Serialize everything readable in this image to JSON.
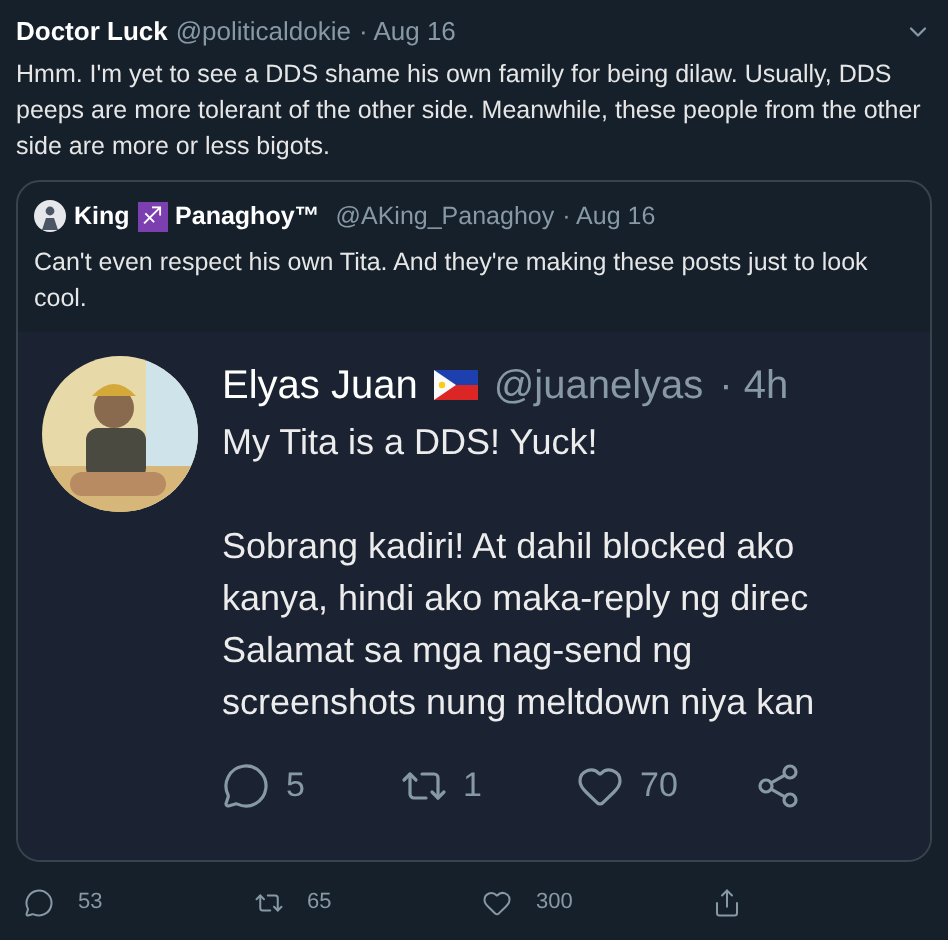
{
  "tweet": {
    "name": "Doctor Luck",
    "handle": "@politicaldokie",
    "time": "· Aug 16",
    "text": "Hmm. I'm yet to see a DDS shame his own family for being dilaw. Usually, DDS peeps are more tolerant of the other side. Meanwhile, these people from the other side are more or less bigots.",
    "quote": {
      "name": "King",
      "symbol": "♐",
      "name_end": "Panaghoy™",
      "handle": "@AKing_Panaghoy",
      "time": "· Aug 16",
      "text": "Can't even respect his own Tita. And they're making these posts just to look cool.",
      "screenshot": {
        "name": "Elyas Juan",
        "handle": "@juanelyas",
        "time": "· 4h",
        "first_line": "My Tita is a DDS! Yuck!",
        "lines": [
          "Sobrang kadiri! At dahil blocked ako",
          "kanya, hindi ako maka-reply ng direc",
          "Salamat sa mga nag-send ng",
          "screenshots nung meltdown niya kan"
        ],
        "actions": [
          {
            "kind": "reply",
            "count": "5"
          },
          {
            "kind": "retweet",
            "count": "1"
          },
          {
            "kind": "like",
            "count": "70"
          },
          {
            "kind": "share"
          }
        ]
      }
    },
    "actions": [
      {
        "kind": "reply",
        "count": "53"
      },
      {
        "kind": "retweet",
        "count": "65"
      },
      {
        "kind": "like",
        "count": "300"
      },
      {
        "kind": "share"
      }
    ]
  }
}
